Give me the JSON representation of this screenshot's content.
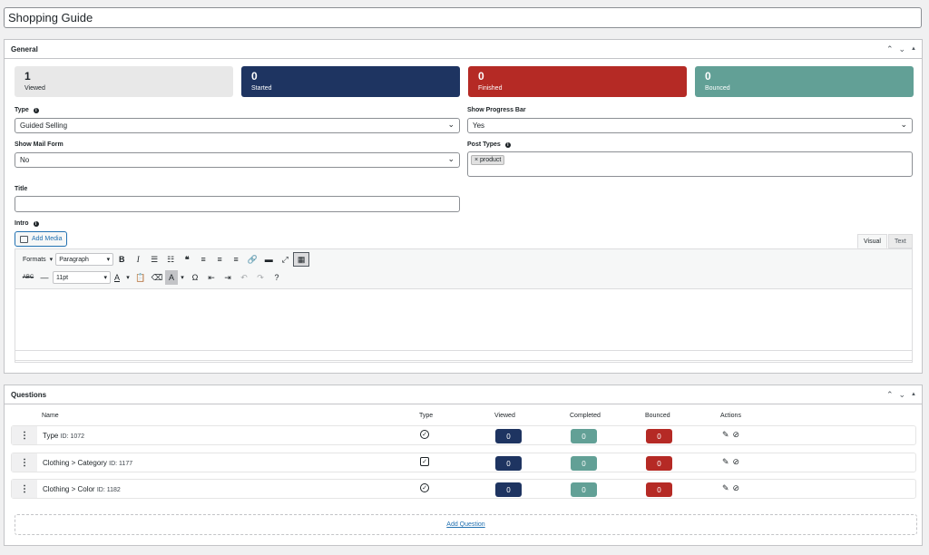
{
  "post_title": "Shopping Guide",
  "general": {
    "title": "General",
    "controls": {
      "up": "⌃",
      "down": "⌄",
      "toggle": "▲"
    },
    "stats": [
      {
        "value": "1",
        "label": "Viewed",
        "color": "#e8e8e8"
      },
      {
        "value": "0",
        "label": "Started",
        "color": "#1e3461"
      },
      {
        "value": "0",
        "label": "Finished",
        "color": "#b52a25"
      },
      {
        "value": "0",
        "label": "Bounced",
        "color": "#62a096"
      }
    ],
    "type": {
      "label": "Type",
      "value": "Guided Selling"
    },
    "progress_bar": {
      "label": "Show Progress Bar",
      "value": "Yes"
    },
    "mail_form": {
      "label": "Show Mail Form",
      "value": "No"
    },
    "post_types": {
      "label": "Post Types",
      "tags": [
        "× product"
      ]
    },
    "title_field": {
      "label": "Title",
      "value": ""
    },
    "intro": {
      "label": "Intro",
      "add_media": "Add Media",
      "tabs": [
        "Visual",
        "Text"
      ],
      "toolbar": {
        "formats": "Formats",
        "block": "Paragraph",
        "font_size": "11pt",
        "row1_icons": [
          "bold-icon",
          "italic-icon",
          "bullet-list-icon",
          "numbered-list-icon",
          "blockquote-icon",
          "align-left-icon",
          "align-center-icon",
          "align-right-icon",
          "link-icon",
          "read-more-icon",
          "fullscreen-icon",
          "toolbar-toggle-icon"
        ],
        "row2_icons": [
          "strikethrough-icon",
          "horizontal-line-icon",
          "text-color-icon",
          "paste-text-icon",
          "clear-format-icon",
          "background-color-icon",
          "special-char-icon",
          "outdent-icon",
          "indent-icon",
          "undo-icon",
          "redo-icon",
          "help-icon"
        ]
      }
    }
  },
  "questions": {
    "title": "Questions",
    "columns": {
      "name": "Name",
      "type": "Type",
      "viewed": "Viewed",
      "completed": "Completed",
      "bounced": "Bounced",
      "actions": "Actions"
    },
    "rows": [
      {
        "name": "Type",
        "id": "ID: 1072",
        "type": "radio",
        "viewed": "0",
        "completed": "0",
        "bounced": "0"
      },
      {
        "name": "Clothing > Category",
        "id": "ID: 1177",
        "type": "checkbox",
        "viewed": "0",
        "completed": "0",
        "bounced": "0"
      },
      {
        "name": "Clothing > Color",
        "id": "ID: 1182",
        "type": "radio",
        "viewed": "0",
        "completed": "0",
        "bounced": "0"
      }
    ],
    "add_label": "Add Question"
  }
}
